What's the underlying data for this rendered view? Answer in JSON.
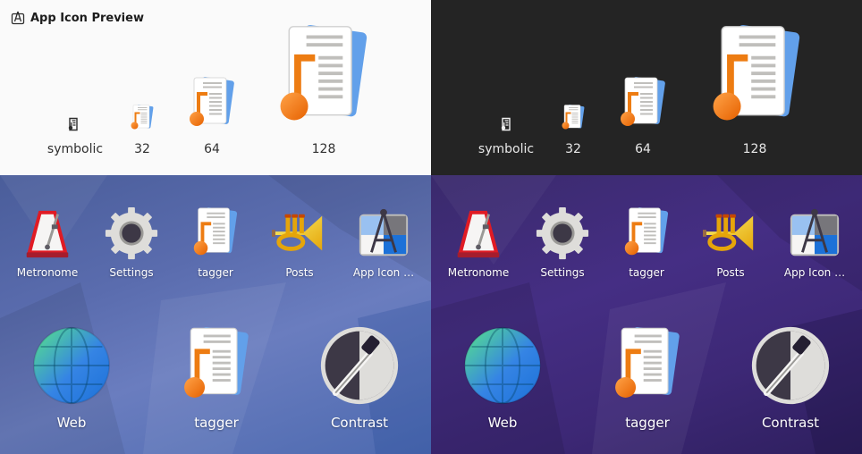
{
  "window": {
    "title": "App Icon Preview"
  },
  "preview_labels": {
    "symbolic": "symbolic",
    "s32": "32",
    "s64": "64",
    "s128": "128"
  },
  "grid_apps": [
    {
      "label": "Metronome",
      "icon": "metronome-icon"
    },
    {
      "label": "Settings",
      "icon": "gear-icon"
    },
    {
      "label": "tagger",
      "icon": "tagger-icon"
    },
    {
      "label": "Posts",
      "icon": "trumpet-icon"
    },
    {
      "label": "App Icon …",
      "icon": "app-icon-preview-icon"
    }
  ],
  "featured_apps": [
    {
      "label": "Web",
      "icon": "globe-icon"
    },
    {
      "label": "tagger",
      "icon": "tagger-icon"
    },
    {
      "label": "Contrast",
      "icon": "contrast-icon"
    }
  ],
  "colors": {
    "light_bg": "#fafafa",
    "dark_bg": "#242424",
    "blue_bg": "#5a6cae",
    "purple_bg": "#452e84",
    "orange_accent": "#ed7c12",
    "doc_blue": "#62a0ea"
  }
}
